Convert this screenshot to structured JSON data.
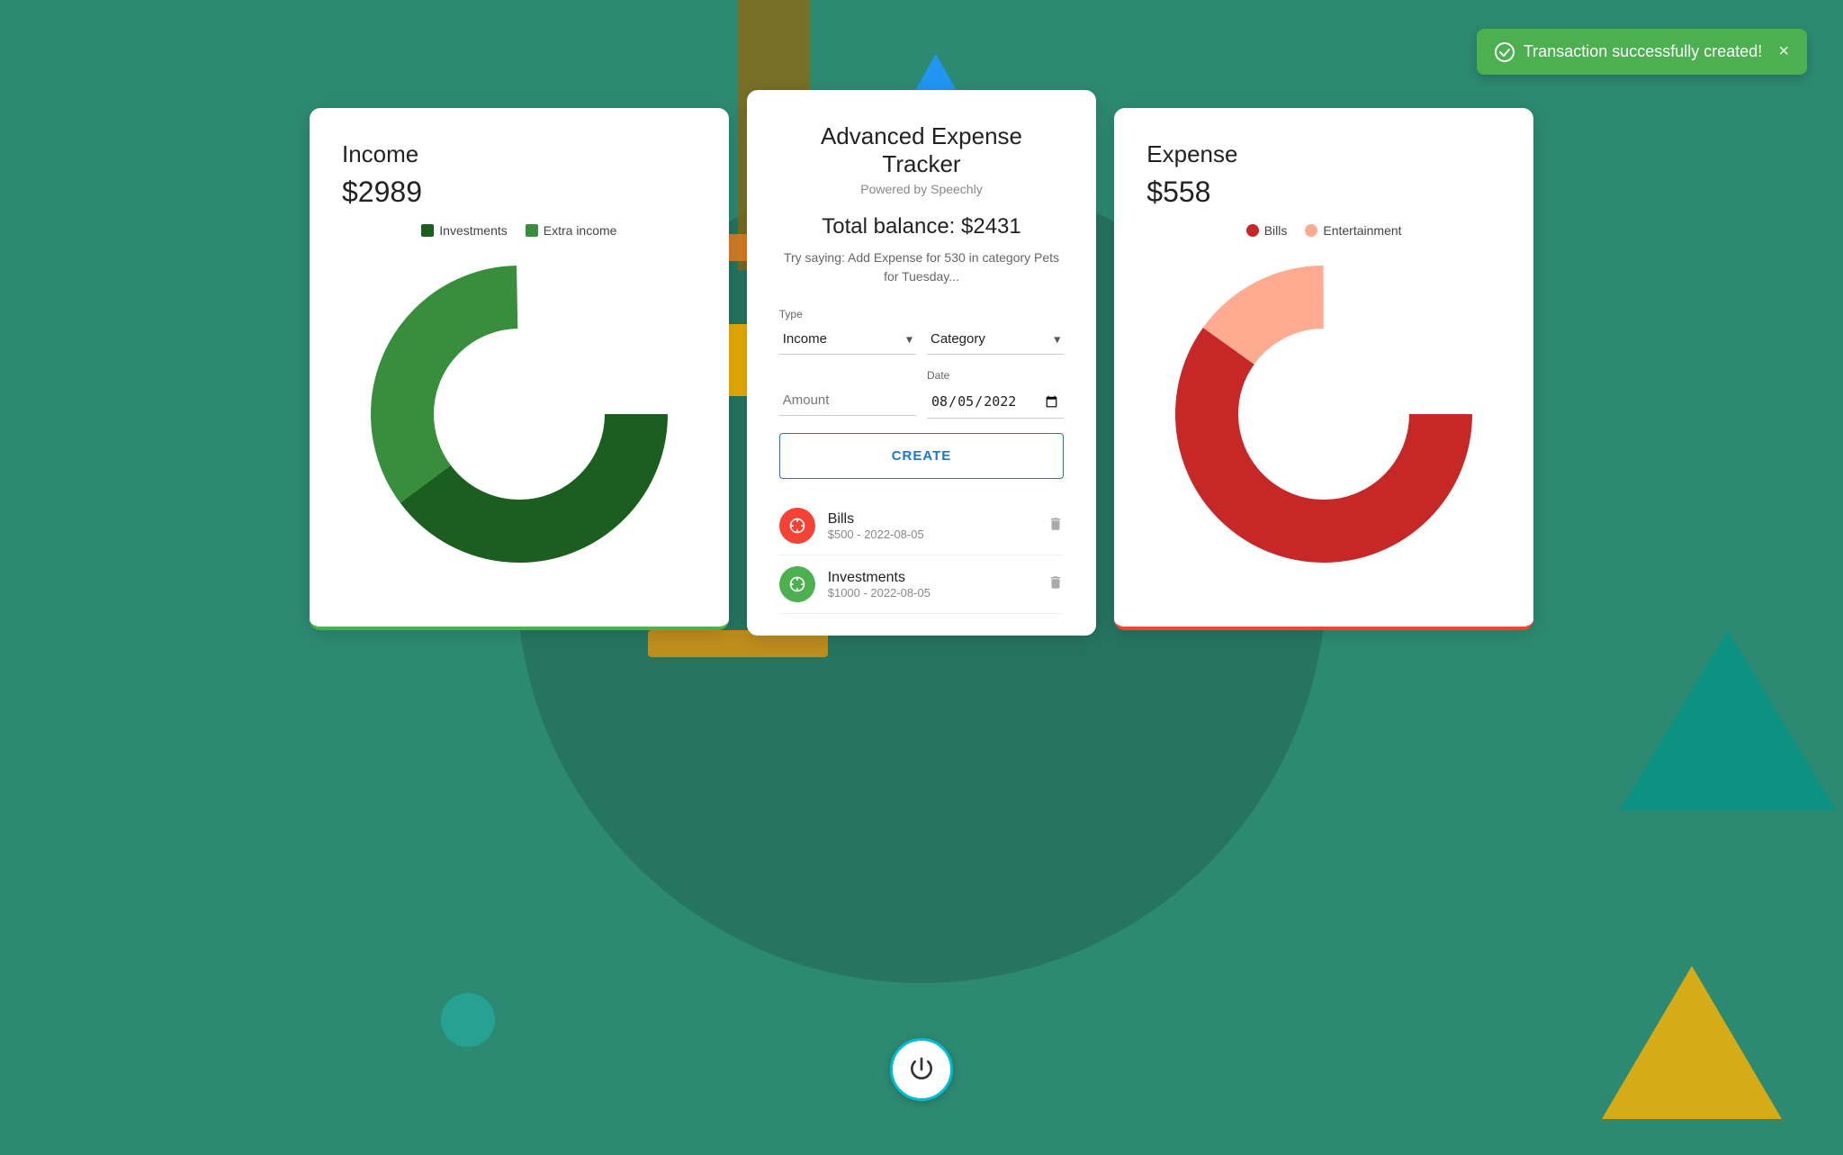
{
  "toast": {
    "message": "Transaction successfully created!",
    "close_label": "×",
    "check_icon": "✓"
  },
  "income_card": {
    "title": "Income",
    "amount": "$2989",
    "legend": [
      {
        "label": "Investments",
        "color": "#1b5e20"
      },
      {
        "label": "Extra income",
        "color": "#2e7d32"
      }
    ],
    "donut": {
      "segments": [
        {
          "color": "#1b5e20",
          "percent": 65
        },
        {
          "color": "#388e3c",
          "percent": 35
        }
      ]
    }
  },
  "center_card": {
    "app_title": "Advanced Expense Tracker",
    "app_subtitle": "Powered by Speechly",
    "total_balance_label": "Total balance: $2431",
    "try_saying": "Try saying: Add Expense for 530 in category Pets for Tuesday...",
    "form": {
      "type_label": "Type",
      "type_value": "Income",
      "category_placeholder": "Category",
      "amount_placeholder": "Amount",
      "date_label": "Date",
      "date_value": "08/05/2022",
      "create_button": "CREATE"
    },
    "transactions": [
      {
        "name": "Bills",
        "meta": "$500 - 2022-08-05",
        "icon_type": "expense",
        "icon_color": "#f44336"
      },
      {
        "name": "Investments",
        "meta": "$1000 - 2022-08-05",
        "icon_type": "income",
        "icon_color": "#4caf50"
      }
    ]
  },
  "expense_card": {
    "title": "Expense",
    "amount": "$558",
    "legend": [
      {
        "label": "Bills",
        "color": "#c62828"
      },
      {
        "label": "Entertainment",
        "color": "#ffab91"
      }
    ],
    "donut": {
      "segments": [
        {
          "color": "#c62828",
          "percent": 85
        },
        {
          "color": "#ffab91",
          "percent": 15
        }
      ]
    }
  },
  "power_button": {
    "label": "power"
  }
}
